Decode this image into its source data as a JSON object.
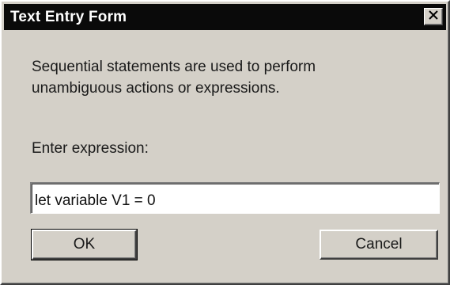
{
  "window": {
    "title": "Text Entry Form",
    "close_icon": "close-x-icon"
  },
  "form": {
    "description_line1": "Sequential statements are used to perform",
    "description_line2": "unambiguous actions or expressions.",
    "prompt_label": "Enter expression:",
    "expression_value": "let variable V1 = 0"
  },
  "buttons": {
    "ok_label": "OK",
    "cancel_label": "Cancel"
  },
  "colors": {
    "titlebar": "#0a0a0a",
    "face": "#d4d0c8",
    "text": "#1a1a1a"
  }
}
